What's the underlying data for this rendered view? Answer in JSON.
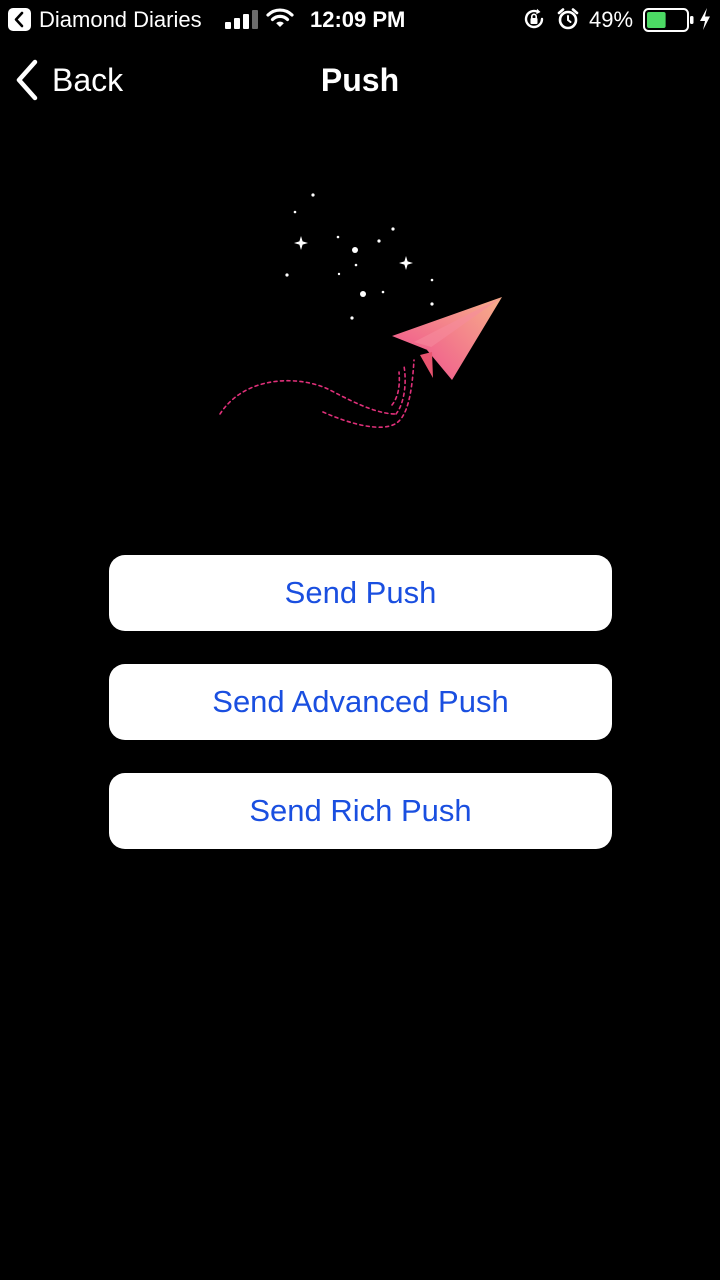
{
  "status_bar": {
    "app_name": "Diamond Diaries",
    "time": "12:09 PM",
    "battery_percent": "49%",
    "battery_level": 0.49,
    "battery_color": "#4cd964",
    "icons": [
      "back-to-app-icon",
      "cellular-signal-icon",
      "wifi-icon",
      "orientation-lock-icon",
      "alarm-icon",
      "battery-icon",
      "charging-bolt-icon"
    ]
  },
  "nav": {
    "back_label": "Back",
    "title": "Push",
    "back_icon": "chevron-left-icon"
  },
  "illustration": {
    "icon": "paper-plane-icon",
    "gradient_start": "#f05a8c",
    "gradient_end": "#f7b08a",
    "trail_color": "#e0307a"
  },
  "buttons": [
    {
      "label": "Send Push"
    },
    {
      "label": "Send Advanced Push"
    },
    {
      "label": "Send Rich Push"
    }
  ],
  "colors": {
    "background": "#000000",
    "button_background": "#ffffff",
    "button_text": "#1a4fe0"
  }
}
